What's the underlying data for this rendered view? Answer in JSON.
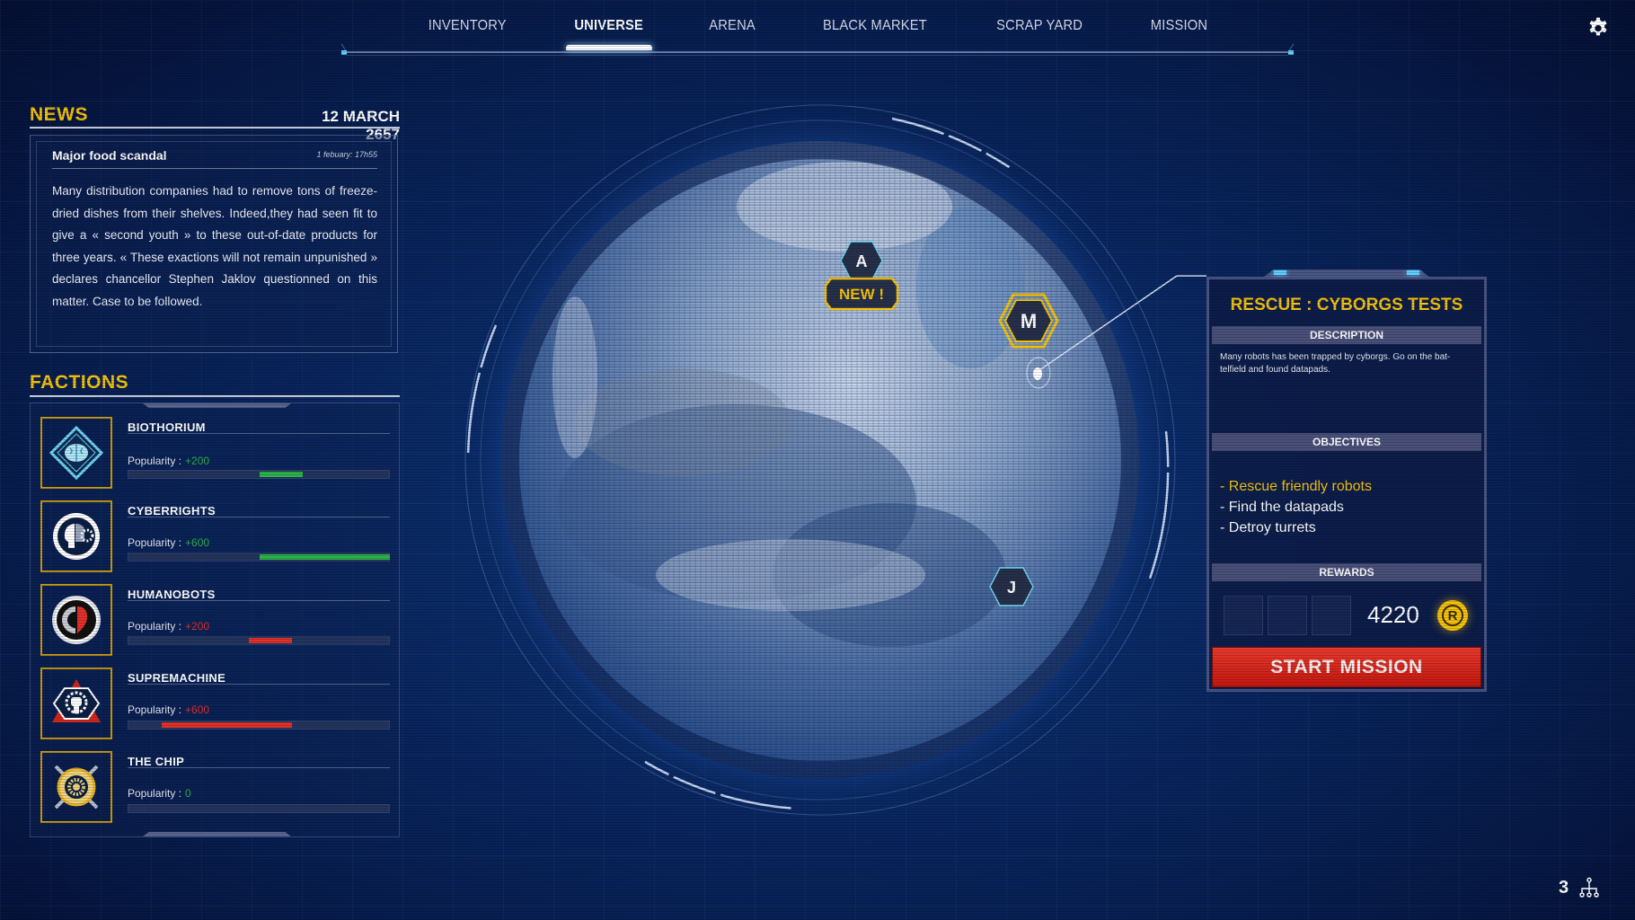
{
  "nav": {
    "items": [
      {
        "label": "INVENTORY",
        "active": false
      },
      {
        "label": "UNIVERSE",
        "active": true
      },
      {
        "label": "ARENA",
        "active": false
      },
      {
        "label": "BLACK MARKET",
        "active": false
      },
      {
        "label": "SCRAP YARD",
        "active": false
      },
      {
        "label": "MISSION",
        "active": false
      }
    ],
    "settings_icon": "gear-icon"
  },
  "news": {
    "title": "NEWS",
    "date": "12 MARCH 2657",
    "article": {
      "headline": "Major food scandal",
      "timestamp": "1 febuary: 17h55",
      "body": "Many distribution companies had to remove tons of freeze-dried dishes from their shelves. Indeed,they had seen fit to give a « second youth » to these out-of-date products for three years. « These exactions will not remain unpunished » declares chancellor Stephen Jaklov questionned on this matter. Case to be followed."
    }
  },
  "factions": {
    "title": "FACTIONS",
    "popularity_label": "Popularity :",
    "colors": {
      "positive": "#2db34a",
      "negative": "#e0322a"
    },
    "items": [
      {
        "name": "BIOTHORIUM",
        "popularity": "+200",
        "value": 200,
        "trend": "positive",
        "icon": "brain-diamond-icon"
      },
      {
        "name": "CYBERRIGHTS",
        "popularity": "+600",
        "value": 600,
        "trend": "positive",
        "icon": "head-gear-icon"
      },
      {
        "name": "HUMANOBOTS",
        "popularity": "+200",
        "value": -200,
        "trend": "negative",
        "icon": "gear-heart-icon"
      },
      {
        "name": "SUPREMACHINE",
        "popularity": "+600",
        "value": -600,
        "trend": "negative",
        "icon": "fist-gear-icon"
      },
      {
        "name": "THE CHIP",
        "popularity": "0",
        "value": 0,
        "trend": "positive",
        "icon": "chip-gear-icon"
      }
    ]
  },
  "planet": {
    "markers": [
      {
        "letter": "A",
        "style": "normal",
        "badge": "NEW !"
      },
      {
        "letter": "M",
        "style": "selected"
      },
      {
        "letter": "J",
        "style": "normal"
      }
    ]
  },
  "mission": {
    "title": "RESCUE : CYBORGS TESTS",
    "description_header": "DESCRIPTION",
    "description": "Many robots has been trapped by cyborgs. Go on the bat-telfield and found datapads.",
    "objectives_header": "OBJECTIVES",
    "objectives": [
      {
        "text": "- Rescue friendly robots",
        "highlight": true
      },
      {
        "text": "- Find the datapads",
        "highlight": false
      },
      {
        "text": "- Detroy turrets",
        "highlight": false
      }
    ],
    "rewards_header": "REWARDS",
    "reward_amount": "4220",
    "currency_symbol": "R",
    "start_label": "START MISSION"
  },
  "footer": {
    "count": "3",
    "icon": "hierarchy-icon"
  }
}
